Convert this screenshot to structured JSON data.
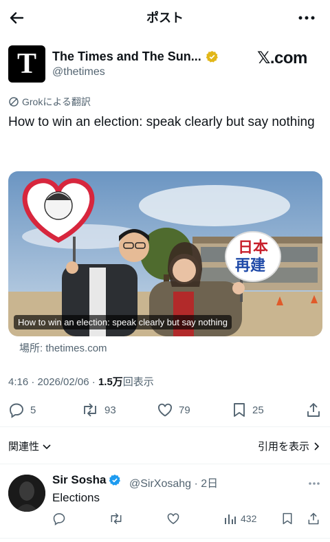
{
  "header": {
    "title": "ポスト"
  },
  "tweet": {
    "author_name": "The Times and The Sun...",
    "author_handle": "@thetimes",
    "avatar_letter": "T",
    "source_badge": "𝕏.com",
    "translation_label": "Grokによる翻訳",
    "text": "How to win an election: speak clearly but say nothing",
    "media_caption": "How to win an election: speak clearly but say nothing",
    "sign_text": "日本\n再建",
    "location": "場所: thetimes.com",
    "time": "4:16 · 2026/02/06 · ",
    "views_count": "1.5万",
    "views_label": "回表示",
    "replies": "5",
    "reposts": "93",
    "likes": "79",
    "bookmarks": "25"
  },
  "related": {
    "label": "関連性",
    "show_quotes": "引用を表示"
  },
  "reply": {
    "name": "Sir Sosha",
    "handle": "@SirXosahg · 2日",
    "text": "Elections",
    "views": "432"
  },
  "colors": {
    "verified_gold": "#e2b719",
    "verified_blue": "#1d9bf0",
    "secondary": "#536471"
  }
}
